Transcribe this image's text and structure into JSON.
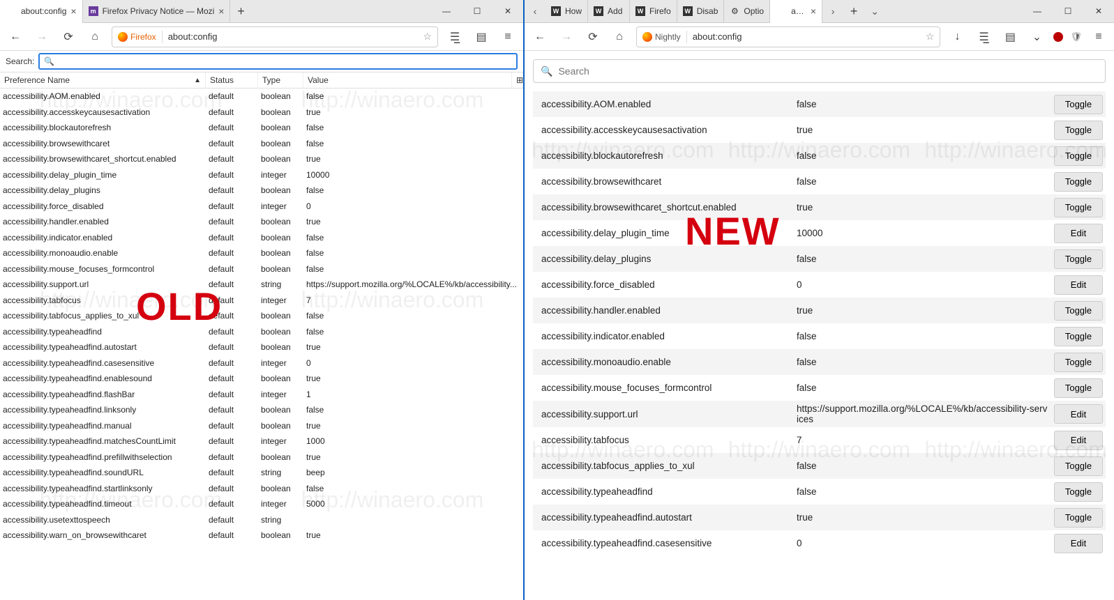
{
  "left": {
    "big_label": "OLD",
    "tabs": [
      {
        "title": "about:config",
        "active": true,
        "icon": "blank"
      },
      {
        "title": "Firefox Privacy Notice — Mozi",
        "active": false,
        "icon": "m"
      }
    ],
    "toolbar": {
      "identity": "Firefox",
      "address": "about:config"
    },
    "search_label": "Search:",
    "columns": {
      "name": "Preference Name",
      "status": "Status",
      "type": "Type",
      "value": "Value"
    },
    "rows": [
      {
        "name": "accessibility.AOM.enabled",
        "status": "default",
        "type": "boolean",
        "value": "false"
      },
      {
        "name": "accessibility.accesskeycausesactivation",
        "status": "default",
        "type": "boolean",
        "value": "true"
      },
      {
        "name": "accessibility.blockautorefresh",
        "status": "default",
        "type": "boolean",
        "value": "false"
      },
      {
        "name": "accessibility.browsewithcaret",
        "status": "default",
        "type": "boolean",
        "value": "false"
      },
      {
        "name": "accessibility.browsewithcaret_shortcut.enabled",
        "status": "default",
        "type": "boolean",
        "value": "true"
      },
      {
        "name": "accessibility.delay_plugin_time",
        "status": "default",
        "type": "integer",
        "value": "10000"
      },
      {
        "name": "accessibility.delay_plugins",
        "status": "default",
        "type": "boolean",
        "value": "false"
      },
      {
        "name": "accessibility.force_disabled",
        "status": "default",
        "type": "integer",
        "value": "0"
      },
      {
        "name": "accessibility.handler.enabled",
        "status": "default",
        "type": "boolean",
        "value": "true"
      },
      {
        "name": "accessibility.indicator.enabled",
        "status": "default",
        "type": "boolean",
        "value": "false"
      },
      {
        "name": "accessibility.monoaudio.enable",
        "status": "default",
        "type": "boolean",
        "value": "false"
      },
      {
        "name": "accessibility.mouse_focuses_formcontrol",
        "status": "default",
        "type": "boolean",
        "value": "false"
      },
      {
        "name": "accessibility.support.url",
        "status": "default",
        "type": "string",
        "value": "https://support.mozilla.org/%LOCALE%/kb/accessibility..."
      },
      {
        "name": "accessibility.tabfocus",
        "status": "default",
        "type": "integer",
        "value": "7"
      },
      {
        "name": "accessibility.tabfocus_applies_to_xul",
        "status": "default",
        "type": "boolean",
        "value": "false"
      },
      {
        "name": "accessibility.typeaheadfind",
        "status": "default",
        "type": "boolean",
        "value": "false"
      },
      {
        "name": "accessibility.typeaheadfind.autostart",
        "status": "default",
        "type": "boolean",
        "value": "true"
      },
      {
        "name": "accessibility.typeaheadfind.casesensitive",
        "status": "default",
        "type": "integer",
        "value": "0"
      },
      {
        "name": "accessibility.typeaheadfind.enablesound",
        "status": "default",
        "type": "boolean",
        "value": "true"
      },
      {
        "name": "accessibility.typeaheadfind.flashBar",
        "status": "default",
        "type": "integer",
        "value": "1"
      },
      {
        "name": "accessibility.typeaheadfind.linksonly",
        "status": "default",
        "type": "boolean",
        "value": "false"
      },
      {
        "name": "accessibility.typeaheadfind.manual",
        "status": "default",
        "type": "boolean",
        "value": "true"
      },
      {
        "name": "accessibility.typeaheadfind.matchesCountLimit",
        "status": "default",
        "type": "integer",
        "value": "1000"
      },
      {
        "name": "accessibility.typeaheadfind.prefillwithselection",
        "status": "default",
        "type": "boolean",
        "value": "true"
      },
      {
        "name": "accessibility.typeaheadfind.soundURL",
        "status": "default",
        "type": "string",
        "value": "beep"
      },
      {
        "name": "accessibility.typeaheadfind.startlinksonly",
        "status": "default",
        "type": "boolean",
        "value": "false"
      },
      {
        "name": "accessibility.typeaheadfind.timeout",
        "status": "default",
        "type": "integer",
        "value": "5000"
      },
      {
        "name": "accessibility.usetexttospeech",
        "status": "default",
        "type": "string",
        "value": ""
      },
      {
        "name": "accessibility.warn_on_browsewithcaret",
        "status": "default",
        "type": "boolean",
        "value": "true"
      }
    ]
  },
  "right": {
    "big_label": "NEW",
    "tabs_pre_arrow": "‹",
    "tabs": [
      {
        "title": "How",
        "icon": "wa"
      },
      {
        "title": "Add",
        "icon": "wa"
      },
      {
        "title": "Firefo",
        "icon": "wa"
      },
      {
        "title": "Disab",
        "icon": "wa"
      },
      {
        "title": "Optio",
        "icon": "gear"
      },
      {
        "title": "about:",
        "icon": "blank",
        "active": true
      }
    ],
    "tabs_post_arrow": "›",
    "tabs_dropdown": "⌄",
    "toolbar": {
      "identity": "Nightly",
      "address": "about:config"
    },
    "search_placeholder": "Search",
    "rows": [
      {
        "name": "accessibility.AOM.enabled",
        "value": "false",
        "action": "Toggle"
      },
      {
        "name": "accessibility.accesskeycausesactivation",
        "value": "true",
        "action": "Toggle"
      },
      {
        "name": "accessibility.blockautorefresh",
        "value": "false",
        "action": "Toggle"
      },
      {
        "name": "accessibility.browsewithcaret",
        "value": "false",
        "action": "Toggle"
      },
      {
        "name": "accessibility.browsewithcaret_shortcut.enabled",
        "value": "true",
        "action": "Toggle"
      },
      {
        "name": "accessibility.delay_plugin_time",
        "value": "10000",
        "action": "Edit"
      },
      {
        "name": "accessibility.delay_plugins",
        "value": "false",
        "action": "Toggle"
      },
      {
        "name": "accessibility.force_disabled",
        "value": "0",
        "action": "Edit"
      },
      {
        "name": "accessibility.handler.enabled",
        "value": "true",
        "action": "Toggle"
      },
      {
        "name": "accessibility.indicator.enabled",
        "value": "false",
        "action": "Toggle"
      },
      {
        "name": "accessibility.monoaudio.enable",
        "value": "false",
        "action": "Toggle"
      },
      {
        "name": "accessibility.mouse_focuses_formcontrol",
        "value": "false",
        "action": "Toggle"
      },
      {
        "name": "accessibility.support.url",
        "value": "https://support.mozilla.org/%LOCALE%/kb/accessibility-services",
        "action": "Edit"
      },
      {
        "name": "accessibility.tabfocus",
        "value": "7",
        "action": "Edit"
      },
      {
        "name": "accessibility.tabfocus_applies_to_xul",
        "value": "false",
        "action": "Toggle"
      },
      {
        "name": "accessibility.typeaheadfind",
        "value": "false",
        "action": "Toggle"
      },
      {
        "name": "accessibility.typeaheadfind.autostart",
        "value": "true",
        "action": "Toggle"
      },
      {
        "name": "accessibility.typeaheadfind.casesensitive",
        "value": "0",
        "action": "Edit"
      }
    ]
  }
}
